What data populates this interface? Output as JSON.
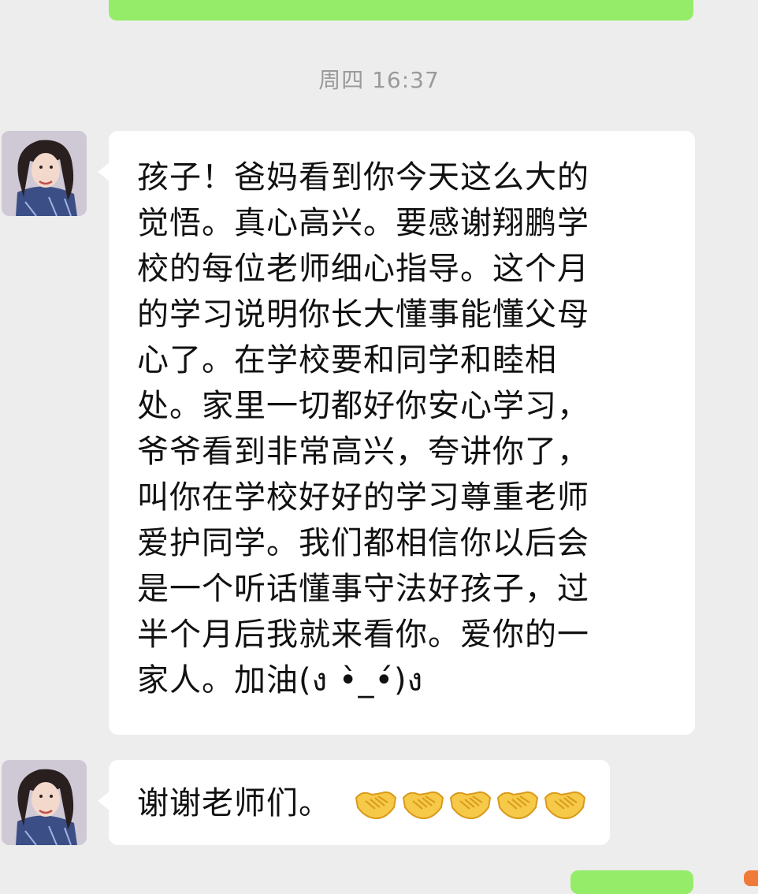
{
  "chat": {
    "timestamp": "周四 16:37",
    "messages": [
      {
        "sender": "incoming",
        "text": "孩子！爸妈看到你今天这么大的\n觉悟。真心高兴。要感谢翔鹏学\n校的每位老师细心指导。这个月\n的学习说明你长大懂事能懂父母\n心了。在学校要和同学和睦相\n处。家里一切都好你安心学习，\n爷爷看到非常高兴，夸讲你了，\n叫你在学校好好的学习尊重老师\n爱护同学。我们都相信你以后会\n是一个听话懂事守法好孩子，过\n半个月后我就来看你。爱你的一\n家人。加油(ง •̀_•́)ง"
      },
      {
        "sender": "incoming",
        "text": "谢谢老师们。",
        "emoji": [
          "handshake-icon",
          "handshake-icon",
          "handshake-icon",
          "handshake-icon",
          "handshake-icon"
        ]
      }
    ]
  },
  "colors": {
    "background": "#ededed",
    "incoming_bubble": "#ffffff",
    "outgoing_bubble": "#95ec69",
    "timestamp_text": "#9a9a9a"
  }
}
